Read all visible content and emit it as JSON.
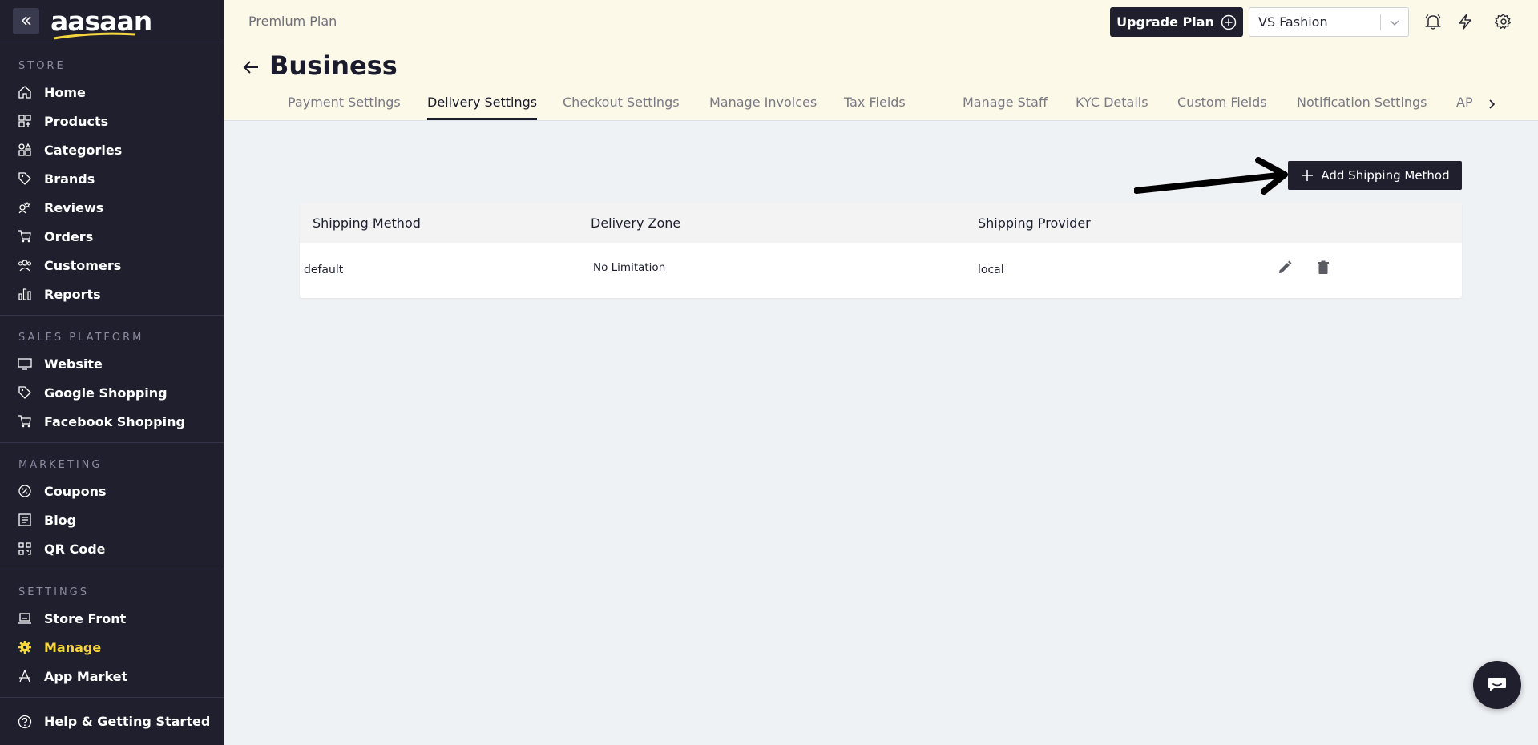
{
  "brand": {
    "name": "aasaan",
    "accent_color": "#f5d63d"
  },
  "sidebar": {
    "store_heading": "STORE",
    "store_items": [
      {
        "label": "Home",
        "icon": "home-icon"
      },
      {
        "label": "Products",
        "icon": "products-icon"
      },
      {
        "label": "Categories",
        "icon": "categories-icon"
      },
      {
        "label": "Brands",
        "icon": "tag-icon"
      },
      {
        "label": "Reviews",
        "icon": "reviews-icon"
      },
      {
        "label": "Orders",
        "icon": "cart-icon"
      },
      {
        "label": "Customers",
        "icon": "users-icon"
      },
      {
        "label": "Reports",
        "icon": "bar-chart-icon"
      }
    ],
    "sales_heading": "SALES PLATFORM",
    "sales_items": [
      {
        "label": "Website",
        "icon": "monitor-icon"
      },
      {
        "label": "Google Shopping",
        "icon": "tag-icon"
      },
      {
        "label": "Facebook Shopping",
        "icon": "cart-icon"
      }
    ],
    "marketing_heading": "MARKETING",
    "marketing_items": [
      {
        "label": "Coupons",
        "icon": "coupon-icon"
      },
      {
        "label": "Blog",
        "icon": "blog-icon"
      },
      {
        "label": "QR Code",
        "icon": "qr-code-icon"
      }
    ],
    "settings_heading": "SETTINGS",
    "settings_items": [
      {
        "label": "Store Front",
        "icon": "storefront-icon"
      },
      {
        "label": "Manage",
        "icon": "gear-icon",
        "active": true
      },
      {
        "label": "App Market",
        "icon": "app-market-icon"
      }
    ],
    "help_label": "Help & Getting Started"
  },
  "header": {
    "plan_label": "Premium Plan",
    "upgrade_label": "Upgrade Plan",
    "store_name": "VS Fashion",
    "page_title": "Business",
    "tabs": [
      {
        "label": "Payment Settings"
      },
      {
        "label": "Delivery Settings",
        "active": true
      },
      {
        "label": "Checkout Settings"
      },
      {
        "label": "Manage Invoices"
      },
      {
        "label": "Tax Fields"
      },
      {
        "label": "Manage Staff"
      },
      {
        "label": "KYC Details"
      },
      {
        "label": "Custom Fields"
      },
      {
        "label": "Notification Settings"
      },
      {
        "label": "AP"
      }
    ]
  },
  "main": {
    "add_button_label": "Add Shipping Method",
    "table": {
      "columns": [
        "Shipping Method",
        "Delivery Zone",
        "Shipping Provider"
      ],
      "rows": [
        {
          "method": "default",
          "zone": "No Limitation",
          "provider": "local"
        }
      ]
    }
  }
}
